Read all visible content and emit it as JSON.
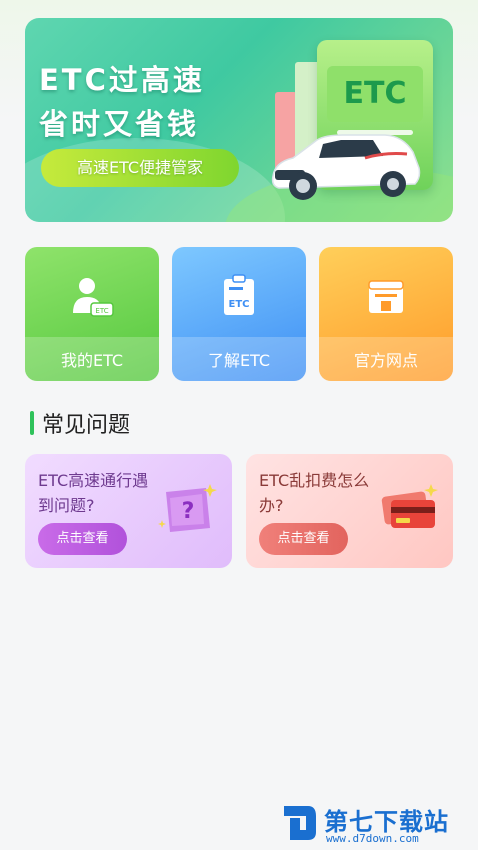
{
  "banner": {
    "title_line1": "ETC过高速",
    "title_line2": "省时又省钱",
    "pill_label": "高速ETC便捷管家",
    "board_text": "ETC"
  },
  "tiles": [
    {
      "label": "我的ETC",
      "icon": "user-card-icon",
      "color": "#55c83e"
    },
    {
      "label": "了解ETC",
      "icon": "etc-document-icon",
      "color": "#3e8ff4"
    },
    {
      "label": "官方网点",
      "icon": "service-point-icon",
      "color": "#ff9b2a"
    }
  ],
  "section": {
    "title": "常见问题",
    "accent": "#2fc25b"
  },
  "faq": [
    {
      "question": "ETC高速通行遇到问题?",
      "button": "点击查看",
      "icon": "question-box-icon"
    },
    {
      "question": "ETC乱扣费怎么办?",
      "button": "点击查看",
      "icon": "credit-card-icon"
    }
  ],
  "watermark": {
    "title": "第七下载站",
    "url": "www.d7down.com"
  }
}
